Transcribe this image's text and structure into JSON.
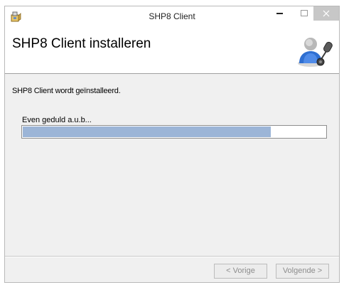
{
  "window": {
    "title": "SHP8 Client",
    "app_icon": "installer-icon"
  },
  "header": {
    "title": "SHP8 Client installeren",
    "icon": "user-microphone-icon"
  },
  "body": {
    "status_text": "SHP8 Client wordt geïnstalleerd.",
    "wait_text": "Even geduld a.u.b...",
    "progress_fraction": 0.82
  },
  "buttons": {
    "back_label": "< Vorige",
    "next_label": "Volgende >"
  },
  "colors": {
    "progress_fill": "#9cb5d7",
    "close_button": "#c7c7c7",
    "disabled_text": "#8d8d8d"
  }
}
